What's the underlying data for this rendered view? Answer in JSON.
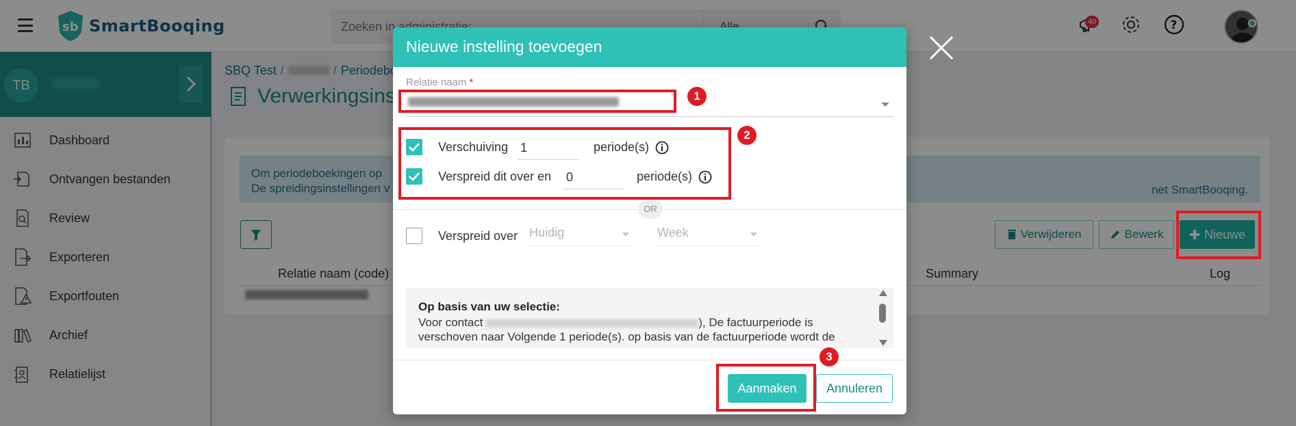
{
  "app": {
    "logo_text": "SmartBooqing",
    "search_placeholder": "Zoeken in administratie: ...",
    "search_scope": "Alle",
    "notification_count": "40"
  },
  "sidebar": {
    "initials": "TB",
    "items": [
      {
        "label": "Dashboard"
      },
      {
        "label": "Ontvangen bestanden"
      },
      {
        "label": "Review"
      },
      {
        "label": "Exporteren"
      },
      {
        "label": "Exportfouten"
      },
      {
        "label": "Archief"
      },
      {
        "label": "Relatielijst"
      }
    ]
  },
  "breadcrumb": {
    "root": "SBQ Test",
    "sep1": "/",
    "sep2": "/",
    "current": "Periodebo"
  },
  "page": {
    "title": "Verwerkingsins",
    "info_line1": "Om periodeboekingen op",
    "info_line2": "De spreidingsinstellingen v",
    "info_tail": "net SmartBooqing."
  },
  "toolbar": {
    "delete_label": "Verwijderen",
    "edit_label": "Bewerk",
    "new_label": "Nieuwe"
  },
  "table": {
    "col_relation": "Relatie naam (code)",
    "col_summary": "Summary",
    "col_log": "Log"
  },
  "modal": {
    "title": "Nieuwe instelling toevoegen",
    "relation_label": "Relatie naam",
    "required_mark": "*",
    "shift_label": "Verschuiving",
    "shift_value": "1",
    "shift_unit": "periode(s)",
    "spread_label": "Verspreid dit over en",
    "spread_value": "0",
    "spread_unit": "periode(s)",
    "or_label": "OR",
    "spread_over_label": "Verspreid over",
    "spread_over_period": "Huidig",
    "spread_over_unit": "Week",
    "summary_title": "Op basis van uw selectie:",
    "summary_prefix": "Voor contact",
    "summary_mid": "), De factuurperiode is",
    "summary_line2": "verschoven naar Volgende 1 periode(s). op basis van de factuurperiode wordt de",
    "create_label": "Aanmaken",
    "cancel_label": "Annuleren"
  },
  "annotations": {
    "one": "1",
    "two": "2",
    "three": "3"
  },
  "colors": {
    "accent": "#2fc0b7",
    "annotation": "#e01b24"
  }
}
